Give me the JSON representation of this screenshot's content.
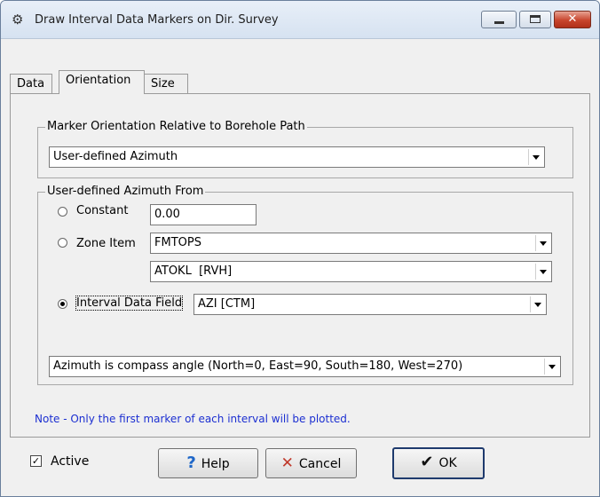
{
  "window": {
    "title": "Draw Interval Data Markers on Dir. Survey",
    "icon": "gear-icon"
  },
  "tabs": [
    {
      "label": "Data",
      "active": false
    },
    {
      "label": "Orientation",
      "active": true
    },
    {
      "label": "Size",
      "active": false
    }
  ],
  "marker_orientation": {
    "legend": "Marker Orientation Relative to Borehole Path",
    "selected": "User-defined Azimuth"
  },
  "azimuth_from": {
    "legend": "User-defined Azimuth From",
    "constant": {
      "label": "Constant",
      "value": "0.00",
      "checked": false
    },
    "zone_item": {
      "label": "Zone Item",
      "zone": "FMTOPS",
      "item": "ATOKL  [RVH]",
      "checked": false
    },
    "interval_field": {
      "label": "Interval Data Field",
      "value": "AZI [CTM]",
      "checked": true
    },
    "angle_mode": "Azimuth is compass angle (North=0, East=90, South=180, West=270)"
  },
  "note": "Note - Only the first marker of each interval will be plotted.",
  "footer": {
    "active_label": "Active",
    "active_checked": true,
    "help_label": "Help",
    "cancel_label": "Cancel",
    "ok_label": "OK"
  }
}
